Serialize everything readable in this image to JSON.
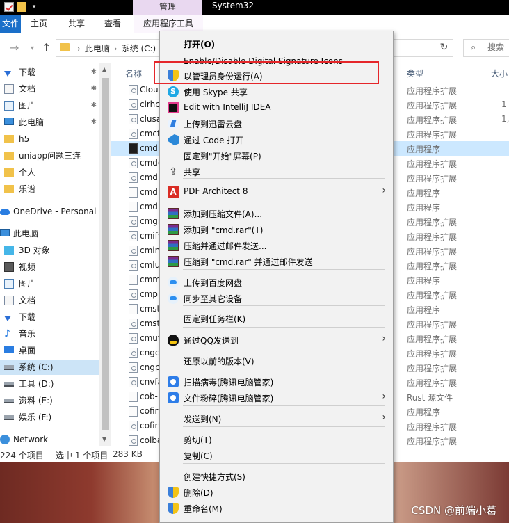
{
  "titlebar": {
    "manage_label": "管理",
    "title": "System32"
  },
  "ribbon": {
    "file": "文件",
    "home": "主页",
    "share": "共享",
    "view": "查看",
    "app_tools": "应用程序工具"
  },
  "nav": {
    "crumbs": [
      "此电脑",
      "系统 (C:)"
    ],
    "search_placeholder": "搜索"
  },
  "sidebar": {
    "items": [
      {
        "label": "下载",
        "icon": "download-icon",
        "pinned": true
      },
      {
        "label": "文档",
        "icon": "document-icon",
        "pinned": true
      },
      {
        "label": "图片",
        "icon": "picture-icon",
        "pinned": true
      },
      {
        "label": "此电脑",
        "icon": "pc-icon",
        "pinned": true
      },
      {
        "label": "h5",
        "icon": "folder-icon",
        "pinned": false
      },
      {
        "label": "uniapp问题三连",
        "icon": "folder-icon",
        "pinned": false
      },
      {
        "label": "个人",
        "icon": "folder-icon",
        "pinned": false
      },
      {
        "label": "乐谱",
        "icon": "folder-icon",
        "pinned": false
      },
      {
        "label": "OneDrive - Personal",
        "icon": "cloud-icon",
        "pinned": false
      },
      {
        "label": "此电脑",
        "icon": "pc-icon",
        "pinned": false
      },
      {
        "label": "3D 对象",
        "icon": "3d-objects-icon",
        "pinned": false
      },
      {
        "label": "视频",
        "icon": "video-icon",
        "pinned": false
      },
      {
        "label": "图片",
        "icon": "picture-icon",
        "pinned": false
      },
      {
        "label": "文档",
        "icon": "document-icon",
        "pinned": false
      },
      {
        "label": "下载",
        "icon": "download-icon",
        "pinned": false
      },
      {
        "label": "音乐",
        "icon": "music-icon",
        "pinned": false
      },
      {
        "label": "桌面",
        "icon": "desktop-icon",
        "pinned": false
      },
      {
        "label": "系统 (C:)",
        "icon": "drive-icon",
        "pinned": false,
        "selected": true
      },
      {
        "label": "工具 (D:)",
        "icon": "drive-icon",
        "pinned": false
      },
      {
        "label": "资料 (E:)",
        "icon": "drive-icon",
        "pinned": false
      },
      {
        "label": "娱乐 (F:)",
        "icon": "drive-icon",
        "pinned": false
      },
      {
        "label": "Network",
        "icon": "network-icon",
        "pinned": false
      }
    ]
  },
  "columns": {
    "name": "名称",
    "type": "类型",
    "size": "大小"
  },
  "files": [
    {
      "name": "Clou",
      "type": "应用程序扩展",
      "size": "",
      "kind": "dll"
    },
    {
      "name": "clrhc",
      "type": "应用程序扩展",
      "size": "1",
      "kind": "dll"
    },
    {
      "name": "clusa",
      "type": "应用程序扩展",
      "size": "1,",
      "kind": "dll"
    },
    {
      "name": "cmcf",
      "type": "应用程序扩展",
      "size": "",
      "kind": "dll"
    },
    {
      "name": "cmd.",
      "type": "应用程序",
      "size": "",
      "kind": "exe",
      "selected": true
    },
    {
      "name": "cmdc",
      "type": "应用程序扩展",
      "size": "",
      "kind": "dll"
    },
    {
      "name": "cmdi",
      "type": "应用程序扩展",
      "size": "",
      "kind": "dll"
    },
    {
      "name": "cmdl",
      "type": "应用程序",
      "size": "",
      "kind": "app"
    },
    {
      "name": "cmdl",
      "type": "应用程序",
      "size": "",
      "kind": "app"
    },
    {
      "name": "cmgr",
      "type": "应用程序扩展",
      "size": "",
      "kind": "dll"
    },
    {
      "name": "cmifv",
      "type": "应用程序扩展",
      "size": "",
      "kind": "dll"
    },
    {
      "name": "cmin",
      "type": "应用程序扩展",
      "size": "",
      "kind": "dll"
    },
    {
      "name": "cmlu",
      "type": "应用程序扩展",
      "size": "",
      "kind": "dll"
    },
    {
      "name": "cmm",
      "type": "应用程序",
      "size": "",
      "kind": "app"
    },
    {
      "name": "cmpl",
      "type": "应用程序扩展",
      "size": "",
      "kind": "dll"
    },
    {
      "name": "cmst",
      "type": "应用程序",
      "size": "",
      "kind": "app"
    },
    {
      "name": "cmst",
      "type": "应用程序扩展",
      "size": "",
      "kind": "dll"
    },
    {
      "name": "cmut",
      "type": "应用程序扩展",
      "size": "",
      "kind": "dll"
    },
    {
      "name": "cngc",
      "type": "应用程序扩展",
      "size": "",
      "kind": "dll"
    },
    {
      "name": "cngp",
      "type": "应用程序扩展",
      "size": "",
      "kind": "dll"
    },
    {
      "name": "cnvfa",
      "type": "应用程序扩展",
      "size": "",
      "kind": "dll"
    },
    {
      "name": "cob-",
      "type": "Rust 源文件",
      "size": "",
      "kind": "doc"
    },
    {
      "name": "cofir",
      "type": "应用程序",
      "size": "",
      "kind": "app"
    },
    {
      "name": "cofir",
      "type": "应用程序扩展",
      "size": "",
      "kind": "dll"
    },
    {
      "name": "colba",
      "type": "应用程序扩展",
      "size": "",
      "kind": "dll"
    }
  ],
  "status": {
    "count": "224 个项目",
    "selected": "选中 1 个项目",
    "size": "283 KB"
  },
  "menu": {
    "items": [
      {
        "label": "打开(O)",
        "icon": "",
        "bold": true,
        "submenu": false
      },
      {
        "label": "Enable/Disable Digital Signature Icons",
        "icon": "",
        "submenu": false
      },
      {
        "label": "以管理员身份运行(A)",
        "icon": "shield-icon",
        "submenu": false
      },
      {
        "label": "使用 Skype 共享",
        "icon": "skype-icon",
        "submenu": false
      },
      {
        "label": "Edit with IntelliJ IDEA",
        "icon": "intellij-icon",
        "submenu": false
      },
      {
        "label": "上传到迅雷云盘",
        "icon": "thunder-cloud-icon",
        "submenu": false
      },
      {
        "label": "通过 Code 打开",
        "icon": "vscode-icon",
        "submenu": false
      },
      {
        "label": "固定到\"开始\"屏幕(P)",
        "icon": "",
        "submenu": false
      },
      {
        "label": "共享",
        "icon": "share-icon",
        "submenu": false
      },
      {
        "label": "PDF Architect 8",
        "icon": "pdf-architect-icon",
        "submenu": true
      },
      {
        "label": "添加到压缩文件(A)...",
        "icon": "winrar-icon",
        "submenu": false
      },
      {
        "label": "添加到 \"cmd.rar\"(T)",
        "icon": "winrar-icon",
        "submenu": false
      },
      {
        "label": "压缩并通过邮件发送...",
        "icon": "winrar-icon",
        "submenu": false
      },
      {
        "label": "压缩到 \"cmd.rar\" 并通过邮件发送",
        "icon": "winrar-icon",
        "submenu": false
      },
      {
        "label": "上传到百度网盘",
        "icon": "baidu-netdisk-icon",
        "submenu": false
      },
      {
        "label": "同步至其它设备",
        "icon": "baidu-netdisk-icon",
        "submenu": false
      },
      {
        "label": "固定到任务栏(K)",
        "icon": "",
        "submenu": false
      },
      {
        "label": "通过QQ发送到",
        "icon": "qq-icon",
        "submenu": true
      },
      {
        "label": "还原以前的版本(V)",
        "icon": "",
        "submenu": false
      },
      {
        "label": "扫描病毒(腾讯电脑管家)",
        "icon": "tencent-guard-icon",
        "submenu": false
      },
      {
        "label": "文件粉碎(腾讯电脑管家)",
        "icon": "tencent-guard-icon",
        "submenu": true
      },
      {
        "label": "发送到(N)",
        "icon": "",
        "submenu": true
      },
      {
        "label": "剪切(T)",
        "icon": "",
        "submenu": false
      },
      {
        "label": "复制(C)",
        "icon": "",
        "submenu": false
      },
      {
        "label": "创建快捷方式(S)",
        "icon": "",
        "submenu": false
      },
      {
        "label": "删除(D)",
        "icon": "shield-icon",
        "submenu": false
      },
      {
        "label": "重命名(M)",
        "icon": "shield-icon",
        "submenu": false
      }
    ]
  },
  "watermark": "CSDN @前端小葛"
}
